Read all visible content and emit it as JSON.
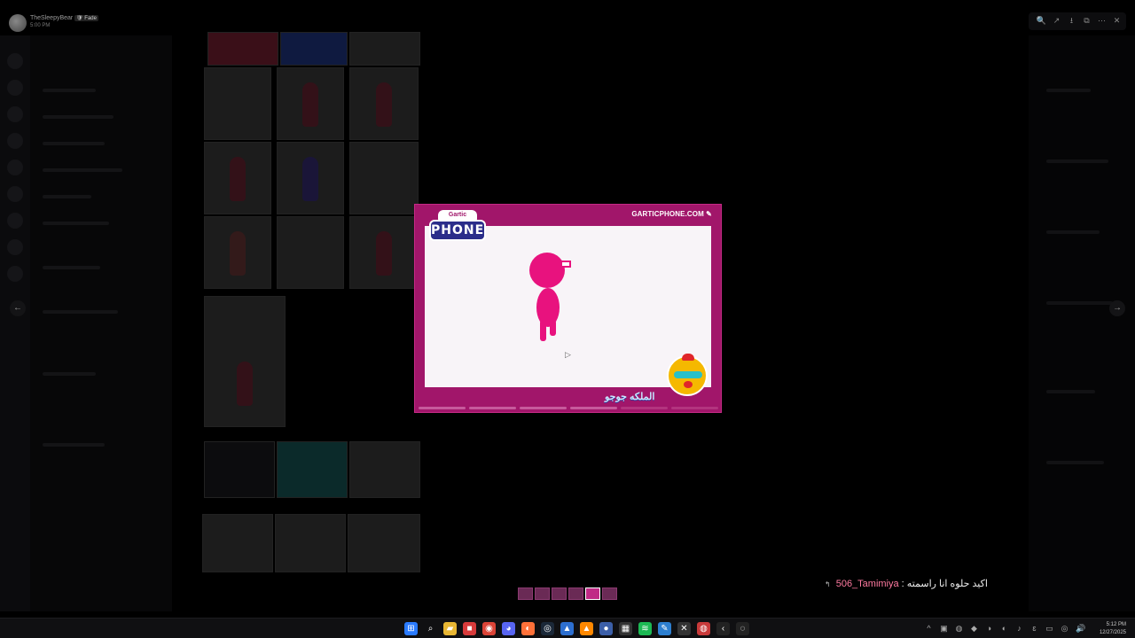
{
  "header": {
    "username": "TheSleepyBear",
    "badge": "🛡 Fade",
    "time": "5:00 PM",
    "tools": [
      "🔍",
      "↗",
      "⭳",
      "⧉",
      "⋯",
      "✕"
    ]
  },
  "nav": {
    "prev": "←",
    "next": "→"
  },
  "card": {
    "site": "GARTICPHONE.COM ✎",
    "logo_top": "Gartic",
    "logo_bottom": "PHONE",
    "caption": "الملكه جوجو",
    "progress_total": 6,
    "progress_filled": 4
  },
  "chat": {
    "icon": "↰",
    "username": "506_Tamimiya",
    "message": " : اكيد حلوه انا راسمته"
  },
  "taskbar": {
    "apps": [
      {
        "name": "windows-start-icon",
        "glyph": "⊞",
        "color": "#2a7bff"
      },
      {
        "name": "search-icon",
        "glyph": "⌕",
        "color": "transparent"
      },
      {
        "name": "file-explorer-icon",
        "glyph": "▰",
        "color": "#e8b633"
      },
      {
        "name": "app-red-icon",
        "glyph": "■",
        "color": "#d83b3b"
      },
      {
        "name": "chrome-icon",
        "glyph": "◉",
        "color": "#db4437"
      },
      {
        "name": "discord-icon",
        "glyph": "◕",
        "color": "#5865f2"
      },
      {
        "name": "firefox-icon",
        "glyph": "◐",
        "color": "#ff7139"
      },
      {
        "name": "steam-icon",
        "glyph": "◎",
        "color": "#1b2838"
      },
      {
        "name": "app-blue-icon",
        "glyph": "▲",
        "color": "#2d6fd0"
      },
      {
        "name": "vlc-icon",
        "glyph": "▲",
        "color": "#ff8800"
      },
      {
        "name": "app-round-icon",
        "glyph": "●",
        "color": "#3c5fa8"
      },
      {
        "name": "calculator-icon",
        "glyph": "▦",
        "color": "#333"
      },
      {
        "name": "spotify-icon",
        "glyph": "≋",
        "color": "#1db954"
      },
      {
        "name": "app-edit-icon",
        "glyph": "✎",
        "color": "#2d7fd0"
      },
      {
        "name": "app-x-icon",
        "glyph": "✕",
        "color": "#333"
      },
      {
        "name": "app-circle-icon",
        "glyph": "◍",
        "color": "#c83a3a"
      },
      {
        "name": "back-icon",
        "glyph": "‹",
        "color": "#222"
      },
      {
        "name": "app-ring-icon",
        "glyph": "◌",
        "color": "#222"
      }
    ],
    "tray": [
      "^",
      "▣",
      "◍",
      "◆",
      "◑",
      "◐",
      "♪",
      "ɛ",
      "▭",
      "◎",
      "🔊"
    ],
    "clock_time": "5:12 PM",
    "clock_date": "12/27/2025"
  }
}
